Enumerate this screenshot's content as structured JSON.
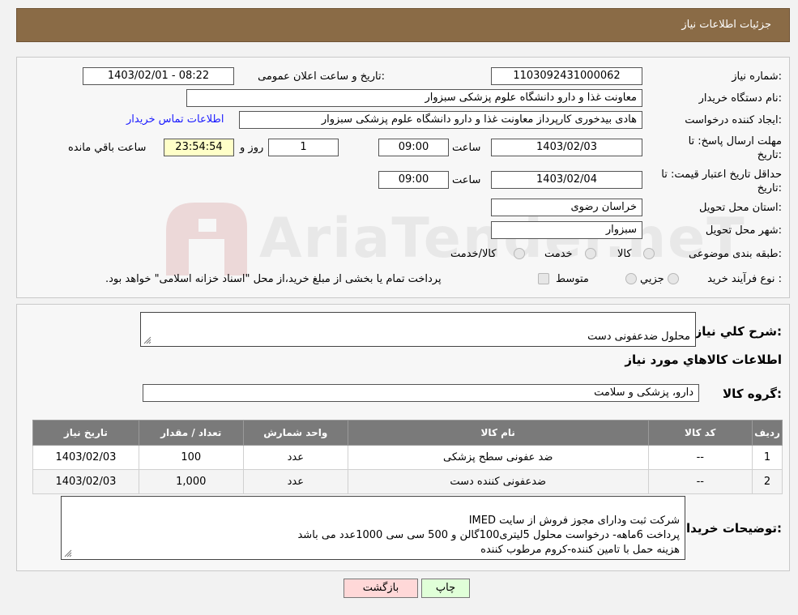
{
  "page": {
    "title": "جزئیات اطلاعات نیاز"
  },
  "form": {
    "need_number_label": "شماره نیاز:",
    "need_number": "1103092431000062",
    "announce_label": "تاریخ و ساعت اعلان عمومی:",
    "announce_value": "1403/02/01 - 08:22",
    "buyer_org_label": "نام دستگاه خریدار:",
    "buyer_org": "معاونت غذا و دارو   دانشگاه علوم پزشکی سبزوار",
    "creator_label": "ایجاد کننده درخواست:",
    "creator": "هادی بیدخوری کارپرداز معاونت غذا و دارو   دانشگاه علوم پزشکی سبزوار",
    "contact_link": "اطلاعات تماس خریدار",
    "deadline_label_1": "مهلت ارسال پاسخ: تا",
    "deadline_label_2": "تاریخ:",
    "deadline_date": "1403/02/03",
    "time_label": "ساعت",
    "deadline_time": "09:00",
    "days_value": "1",
    "days_label": "روز و",
    "remaining_time": "23:54:54",
    "remaining_label": "ساعت باقي مانده",
    "validity_label_1": "حداقل تاريخ اعتبار قيمت: تا",
    "validity_label_2": "تاريخ:",
    "validity_date": "1403/02/04",
    "validity_time_label": "ساعت",
    "validity_time": "09:00",
    "province_label": "استان محل تحویل:",
    "province": "خراسان رضوی",
    "city_label": "شهر محل تحویل:",
    "city": "سبزوار",
    "category_label": "طبقه بندی موضوعی:",
    "category_options": [
      "کالا",
      "خدمت",
      "کالا/خدمت"
    ],
    "process_label": "نوع فرآیند خرید :",
    "process_options": [
      "جزيي",
      "متوسط"
    ],
    "payment_note": "پرداخت تمام یا بخشی از مبلغ خرید،از محل \"اسناد خزانه اسلامی\" خواهد بود."
  },
  "summary": {
    "general_label": "شرح کلي نياز:",
    "general_value": "محلول ضدعفونی دست",
    "goods_info_title": "اطلاعات کالاهاي مورد نياز",
    "goods_group_label": "گروه کالا:",
    "goods_group_value": "دارو، پزشکی و سلامت"
  },
  "table": {
    "headers": [
      "رديف",
      "کد کالا",
      "نام کالا",
      "واحد شمارش",
      "تعداد / مقدار",
      "تاريخ نياز"
    ],
    "rows": [
      [
        "1",
        "--",
        "ضد عفونی سطح پزشکی",
        "عدد",
        "100",
        "1403/02/03"
      ],
      [
        "2",
        "--",
        "ضدعفونی کننده دست",
        "عدد",
        "1,000",
        "1403/02/03"
      ]
    ]
  },
  "notes": {
    "label": "توضيحات خريدار:",
    "value": "شرکت ثبت ودارای مجوز فروش از سایت IMED\nپرداخت 6ماهه- درخواست محلول 5لیتری100گالن و 500 سی سی 1000عدد می باشد\nهزینه حمل با تامین کننده-کروم مرطوب کننده"
  },
  "buttons": {
    "back": "بازگشت",
    "print": "چاپ"
  },
  "watermark": {
    "text": "AriaTender.neT"
  },
  "colors": {
    "title_bar": "#8a6b46",
    "link": "#1a1aff",
    "table_header": "#7a7a7a",
    "back_button": "#ffd8d8",
    "print_button": "#e0ffd8",
    "remaining_bg": "#ffffc8"
  }
}
